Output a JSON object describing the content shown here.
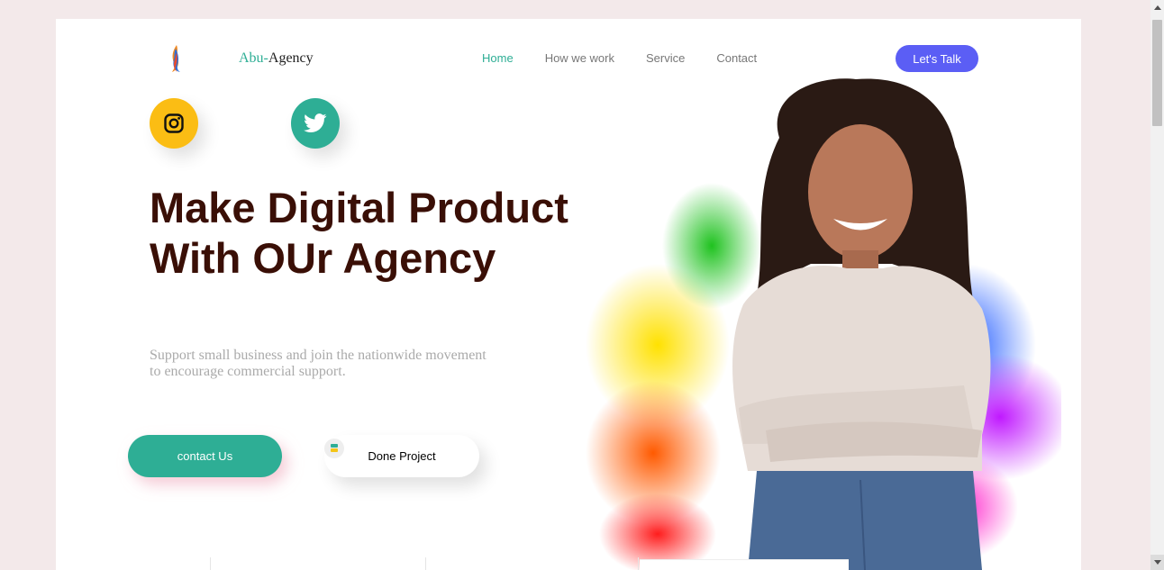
{
  "header": {
    "brand_prefix": "Abu-",
    "brand_suffix": "Agency",
    "nav": [
      {
        "label": "Home",
        "active": true
      },
      {
        "label": "How we work",
        "active": false
      },
      {
        "label": "Service",
        "active": false
      },
      {
        "label": "Contact",
        "active": false
      }
    ],
    "cta_label": "Let's Talk"
  },
  "socials": {
    "instagram_icon": "instagram-icon",
    "twitter_icon": "twitter-icon"
  },
  "hero": {
    "title_line1": "Make Digital Product",
    "title_line2": "With OUr Agency",
    "subtitle_line1": "Support small business and join the nationwide movement",
    "subtitle_line2": "to encourage commercial support.",
    "contact_label": "contact Us",
    "done_label": "Done Project"
  },
  "colors": {
    "accent": "#2eae95",
    "cta": "#5b5ef5",
    "title": "#3a0f06",
    "instagram_bg": "#fbbd14",
    "page_bg": "#f3e9ea"
  }
}
